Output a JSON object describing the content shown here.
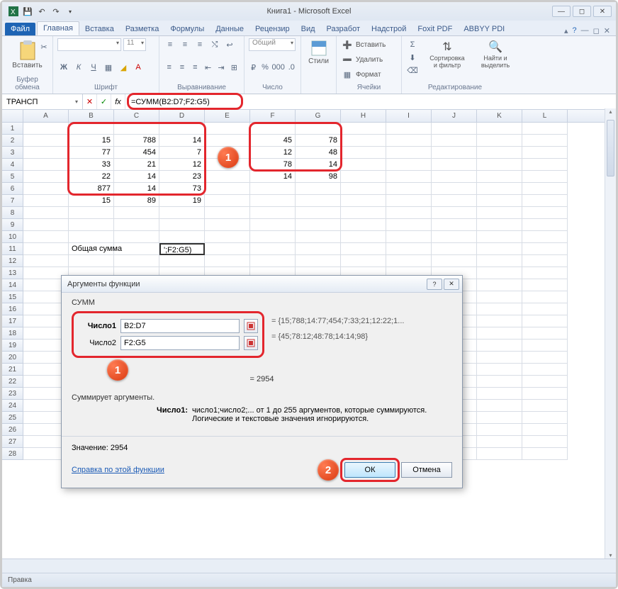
{
  "window": {
    "title": "Книга1 - Microsoft Excel"
  },
  "qat": {
    "save": "💾",
    "undo": "↶",
    "redo": "↷"
  },
  "tabs": {
    "file": "Файл",
    "items": [
      "Главная",
      "Вставка",
      "Разметка",
      "Формулы",
      "Данные",
      "Рецензир",
      "Вид",
      "Разработ",
      "Надстрой",
      "Foxit PDF",
      "ABBYY PDI"
    ],
    "active": 0
  },
  "ribbon": {
    "clipboard": {
      "paste": "Вставить",
      "label": "Буфер обмена"
    },
    "font": {
      "label": "Шрифт",
      "size": "11"
    },
    "align": {
      "label": "Выравнивание"
    },
    "number": {
      "format": "Общий",
      "label": "Число"
    },
    "styles": {
      "btn": "Стили"
    },
    "cells": {
      "insert": "Вставить",
      "delete": "Удалить",
      "format": "Формат",
      "label": "Ячейки"
    },
    "editing": {
      "sort": "Сортировка и фильтр",
      "find": "Найти и выделить",
      "label": "Редактирование"
    }
  },
  "namebox": "ТРАНСП",
  "formula": "=СУММ(B2:D7;F2:G5)",
  "columns": [
    "A",
    "B",
    "C",
    "D",
    "E",
    "F",
    "G",
    "H",
    "I",
    "J",
    "K",
    "L"
  ],
  "data1": [
    [
      "15",
      "788",
      "14"
    ],
    [
      "77",
      "454",
      "7"
    ],
    [
      "33",
      "21",
      "12"
    ],
    [
      "22",
      "14",
      "23"
    ],
    [
      "877",
      "14",
      "73"
    ],
    [
      "15",
      "89",
      "19"
    ]
  ],
  "data2": [
    [
      "45",
      "78"
    ],
    [
      "12",
      "48"
    ],
    [
      "78",
      "14"
    ],
    [
      "14",
      "98"
    ]
  ],
  "row11": {
    "label": "Общая сумма",
    "value": "';F2:G5)"
  },
  "dialog": {
    "title": "Аргументы функции",
    "fn": "СУММ",
    "arg1_label": "Число1",
    "arg1_value": "B2:D7",
    "arg1_preview": "= {15;788;14:77;454;7:33;21;12:22;1...",
    "arg2_label": "Число2",
    "arg2_value": "F2:G5",
    "arg2_preview": "= {45;78:12;48:78;14:14;98}",
    "result_eq": "= 2954",
    "desc": "Суммирует аргументы.",
    "hint_label": "Число1:",
    "hint_text": "число1;число2;... от 1 до 255 аргументов, которые суммируются. Логические и текстовые значения игнорируются.",
    "value_label": "Значение:",
    "value": "2954",
    "help": "Справка по этой функции",
    "ok": "ОК",
    "cancel": "Отмена"
  },
  "status": "Правка",
  "callouts": {
    "c1": "1",
    "c2": "1",
    "c3": "2"
  }
}
